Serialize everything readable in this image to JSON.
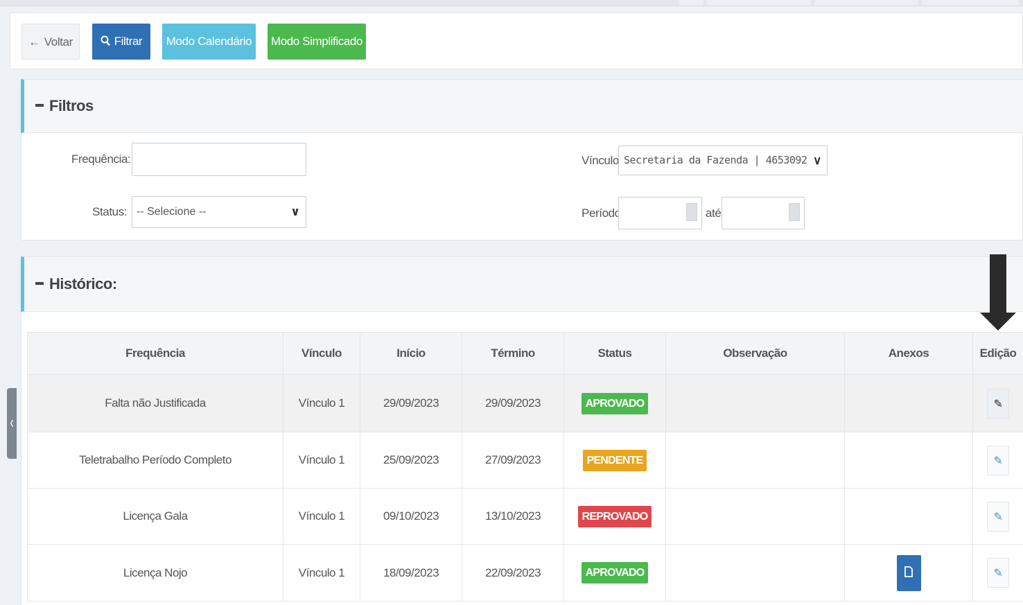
{
  "toolbar": {
    "back_label": "Voltar",
    "filter_label": "Filtrar",
    "calendar_label": "Modo Calendário",
    "simple_label": "Modo Simplificado"
  },
  "filters": {
    "title": "Filtros",
    "frequencia_label": "Frequência:",
    "frequencia_value": "",
    "status_label": "Status:",
    "status_value": "-- Selecione --",
    "vinculo_label": "Vínculo:",
    "vinculo_value": "Secretaria da Fazenda | 4653092",
    "periodo_label": "Período",
    "periodo_ate_label": "até",
    "periodo_start": "",
    "periodo_end": ""
  },
  "history": {
    "title": "Histórico:",
    "columns": [
      "Frequência",
      "Vínculo",
      "Início",
      "Término",
      "Status",
      "Observação",
      "Anexos",
      "Edição"
    ],
    "rows": [
      {
        "frequencia": "Falta não Justificada",
        "vinculo": "Vínculo 1",
        "inicio": "29/09/2023",
        "termino": "29/09/2023",
        "status": "APROVADO",
        "status_color": "#4cb94f",
        "observacao": "",
        "has_attachment": false
      },
      {
        "frequencia": "Teletrabalho Período Completo",
        "vinculo": "Vínculo 1",
        "inicio": "25/09/2023",
        "termino": "27/09/2023",
        "status": "PENDENTE",
        "status_color": "#e9a51d",
        "observacao": "",
        "has_attachment": false
      },
      {
        "frequencia": "Licença Gala",
        "vinculo": "Vínculo 1",
        "inicio": "09/10/2023",
        "termino": "13/10/2023",
        "status": "REPROVADO",
        "status_color": "#e0474c",
        "observacao": "",
        "has_attachment": false
      },
      {
        "frequencia": "Licença Nojo",
        "vinculo": "Vínculo 1",
        "inicio": "18/09/2023",
        "termino": "22/09/2023",
        "status": "APROVADO",
        "status_color": "#4cb94f",
        "observacao": "",
        "has_attachment": true
      }
    ]
  },
  "icons": {
    "back": "arrow-left-icon",
    "filter": "search-icon",
    "edit": "pencil-icon",
    "attachment": "file-icon",
    "calendar": "calendar-icon",
    "collapse": "minus-icon",
    "sidebar_toggle": "chevron-left-icon",
    "annotation": "arrow-down-icon"
  },
  "colors": {
    "primary": "#2f6fb4",
    "info": "#5bc1df",
    "success": "#4cb94f",
    "warning": "#e9a51d",
    "danger": "#e0474c",
    "annotation_arrow": "#2b2b2b"
  }
}
